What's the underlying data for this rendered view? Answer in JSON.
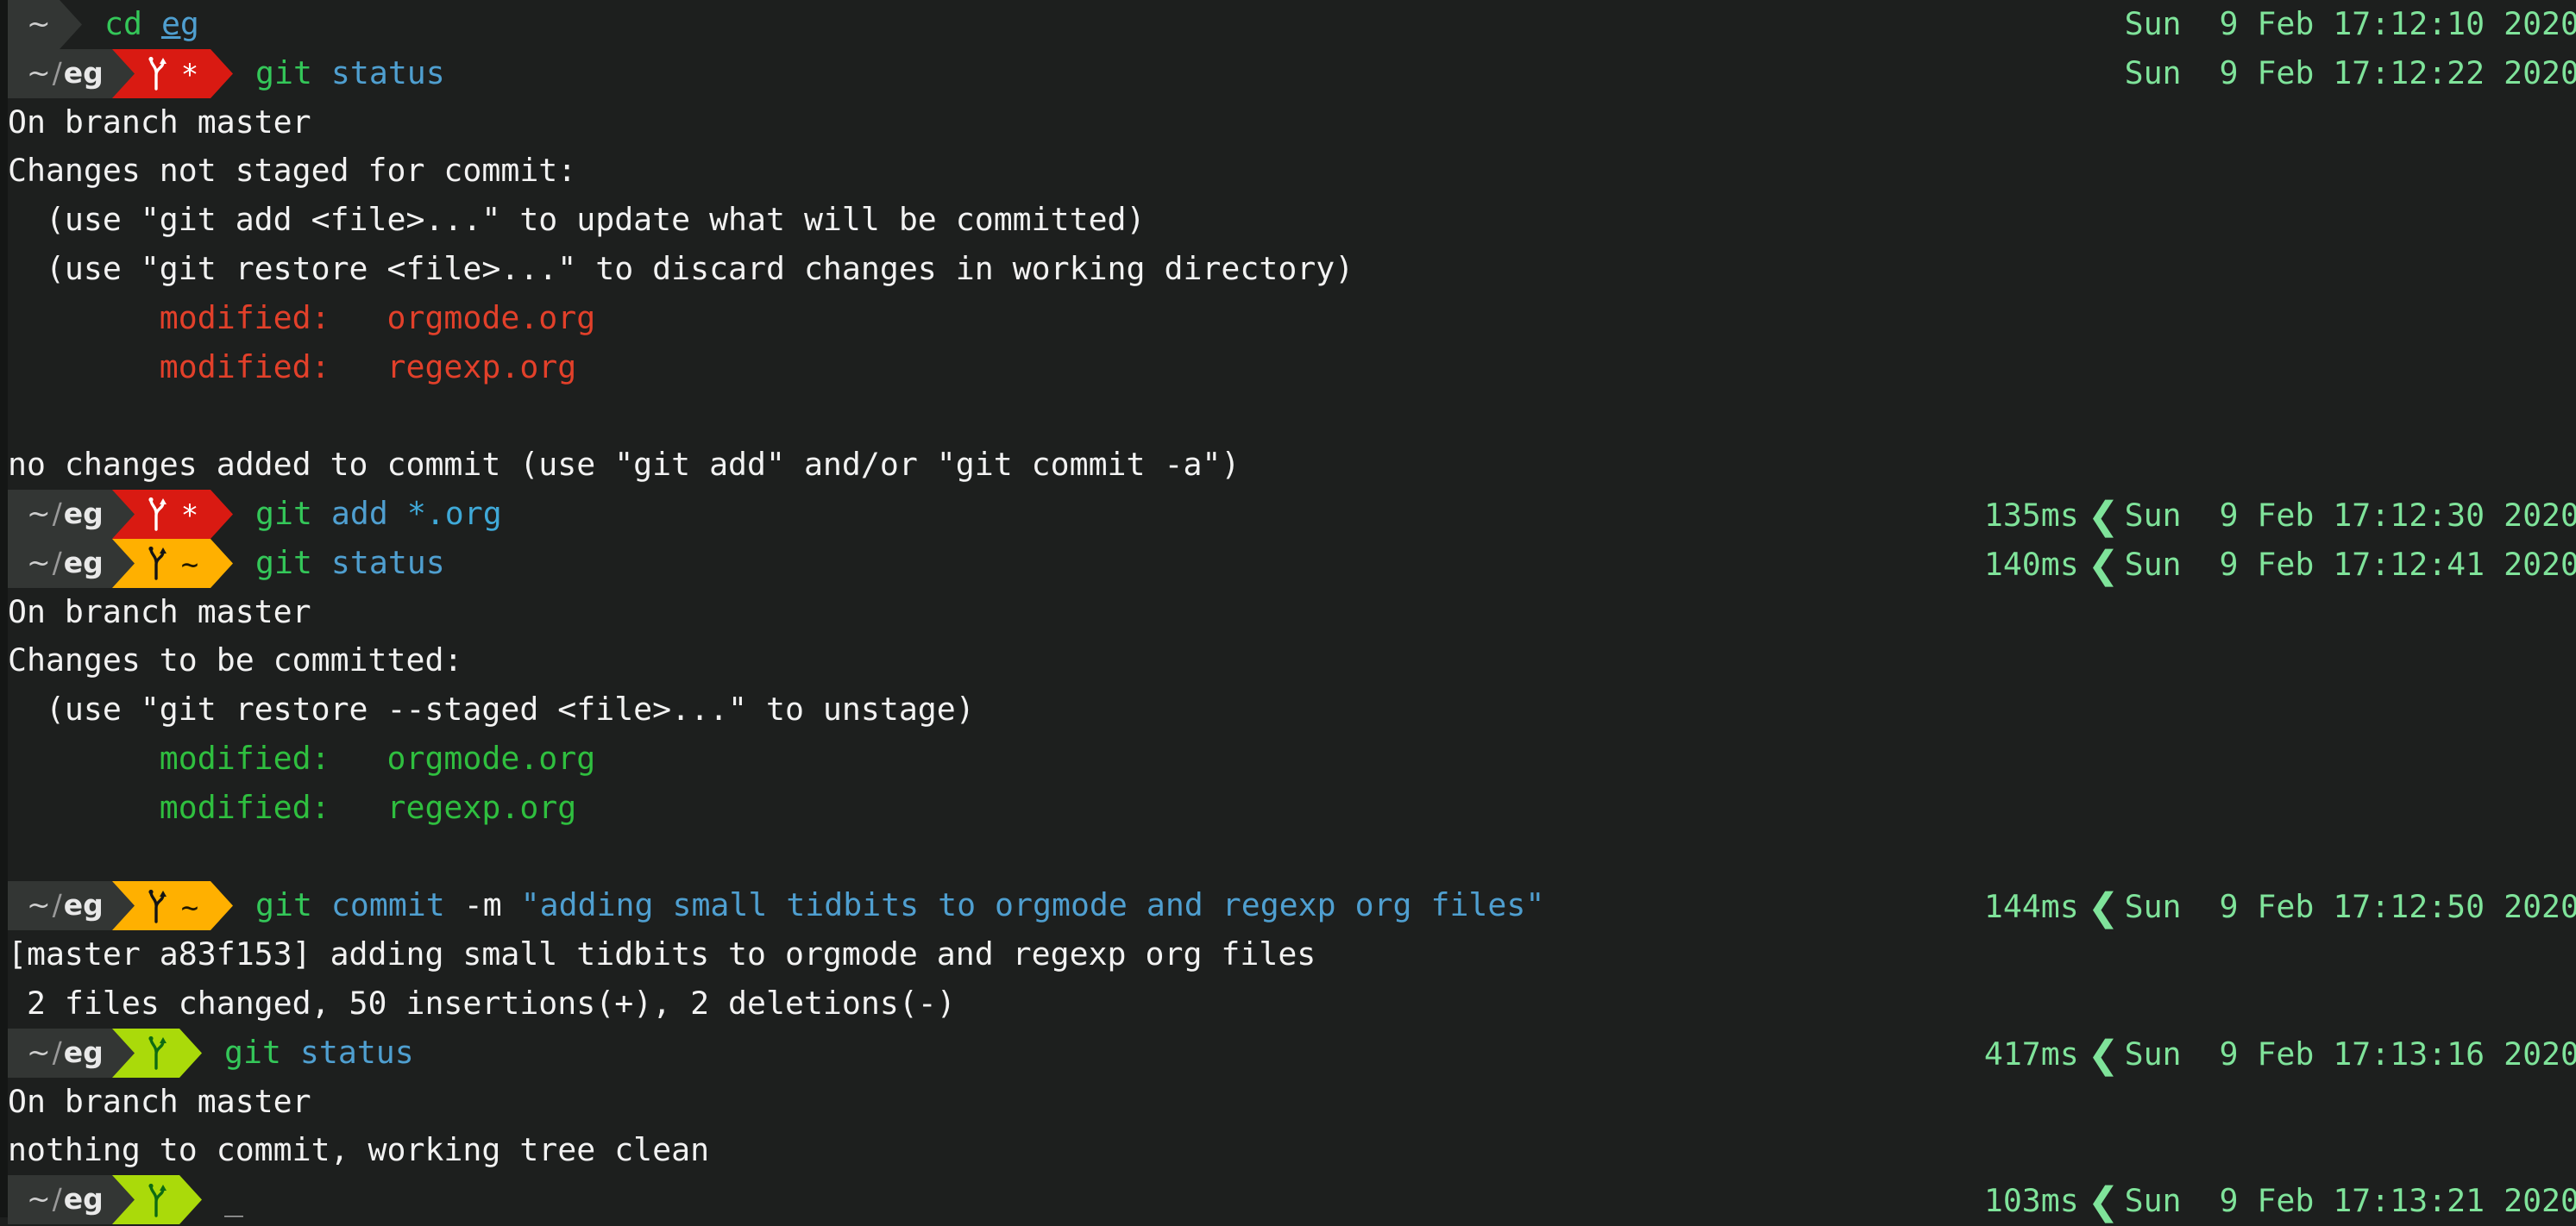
{
  "terminal": {
    "shell": "zsh-powerlevel",
    "colors": {
      "background": "#1d1f1e",
      "prompt_path_bg": "#333634",
      "git_dirty_bg": "#d91a12",
      "git_staged_bg": "#ffb000",
      "git_clean_bg": "#aada0a",
      "timestamp": "#7fe39a",
      "command_name": "#34c759",
      "command_arg": "#4f9fd0",
      "error_red": "#e2402a",
      "success_green": "#2fbf3f",
      "output_white": "#f2f2f2"
    },
    "icons": {
      "branch": "git-branch-icon",
      "separator_right": "powerline-right-arrow-icon",
      "separator_left_thin": "powerline-left-thin-chevron-icon",
      "dirty_mark": "*",
      "staged_mark": "~",
      "cursor": "_"
    }
  },
  "lines": [
    {
      "type": "prompt",
      "path": "~",
      "git": null,
      "command": [
        {
          "t": "cd ",
          "c": "c-green"
        },
        {
          "t": "eg",
          "c": "c-under"
        }
      ],
      "duration": "",
      "timestamp": "Sun  9 Feb 17:12:10 2020"
    },
    {
      "type": "prompt",
      "path": "~/eg",
      "git": {
        "state": "dirty",
        "mark": "*"
      },
      "command": [
        {
          "t": "git ",
          "c": "c-green"
        },
        {
          "t": "status",
          "c": "c-blue"
        }
      ],
      "duration": "",
      "timestamp": "Sun  9 Feb 17:12:22 2020"
    },
    {
      "type": "output",
      "spans": [
        {
          "t": "On branch master",
          "c": "c-white"
        }
      ]
    },
    {
      "type": "output",
      "spans": [
        {
          "t": "Changes not staged for commit:",
          "c": "c-white"
        }
      ]
    },
    {
      "type": "output",
      "spans": [
        {
          "t": "  (use \"git add <file>...\" to update what will be committed)",
          "c": "c-white"
        }
      ]
    },
    {
      "type": "output",
      "spans": [
        {
          "t": "  (use \"git restore <file>...\" to discard changes in working directory)",
          "c": "c-white"
        }
      ]
    },
    {
      "type": "output",
      "spans": [
        {
          "t": "        modified:   orgmode.org",
          "c": "c-red"
        }
      ]
    },
    {
      "type": "output",
      "spans": [
        {
          "t": "        modified:   regexp.org",
          "c": "c-red"
        }
      ]
    },
    {
      "type": "output",
      "spans": [
        {
          "t": "",
          "c": "c-white"
        }
      ]
    },
    {
      "type": "output",
      "spans": [
        {
          "t": "no changes added to commit (use \"git add\" and/or \"git commit -a\")",
          "c": "c-white"
        }
      ]
    },
    {
      "type": "prompt",
      "path": "~/eg",
      "git": {
        "state": "dirty",
        "mark": "*"
      },
      "command": [
        {
          "t": "git ",
          "c": "c-green"
        },
        {
          "t": "add ",
          "c": "c-blue"
        },
        {
          "t": "*.org",
          "c": "c-cyan"
        }
      ],
      "duration": "135ms",
      "timestamp": "Sun  9 Feb 17:12:30 2020"
    },
    {
      "type": "prompt",
      "path": "~/eg",
      "git": {
        "state": "staged",
        "mark": "~"
      },
      "command": [
        {
          "t": "git ",
          "c": "c-green"
        },
        {
          "t": "status",
          "c": "c-blue"
        }
      ],
      "duration": "140ms",
      "timestamp": "Sun  9 Feb 17:12:41 2020"
    },
    {
      "type": "output",
      "spans": [
        {
          "t": "On branch master",
          "c": "c-white"
        }
      ]
    },
    {
      "type": "output",
      "spans": [
        {
          "t": "Changes to be committed:",
          "c": "c-white"
        }
      ]
    },
    {
      "type": "output",
      "spans": [
        {
          "t": "  (use \"git restore --staged <file>...\" to unstage)",
          "c": "c-white"
        }
      ]
    },
    {
      "type": "output",
      "spans": [
        {
          "t": "        modified:   orgmode.org",
          "c": "c-ok"
        }
      ]
    },
    {
      "type": "output",
      "spans": [
        {
          "t": "        modified:   regexp.org",
          "c": "c-ok"
        }
      ]
    },
    {
      "type": "output",
      "spans": [
        {
          "t": "",
          "c": "c-white"
        }
      ]
    },
    {
      "type": "prompt",
      "path": "~/eg",
      "git": {
        "state": "staged",
        "mark": "~"
      },
      "command": [
        {
          "t": "git ",
          "c": "c-green"
        },
        {
          "t": "commit ",
          "c": "c-blue"
        },
        {
          "t": "-m ",
          "c": "c-white"
        },
        {
          "t": "\"adding small tidbits to orgmode and regexp org files\"",
          "c": "c-blue"
        }
      ],
      "duration": "144ms",
      "timestamp": "Sun  9 Feb 17:12:50 2020"
    },
    {
      "type": "output",
      "spans": [
        {
          "t": "[master a83f153] adding small tidbits to orgmode and regexp org files",
          "c": "c-white"
        }
      ]
    },
    {
      "type": "output",
      "spans": [
        {
          "t": " 2 files changed, 50 insertions(+), 2 deletions(-)",
          "c": "c-white"
        }
      ]
    },
    {
      "type": "prompt",
      "path": "~/eg",
      "git": {
        "state": "clean",
        "mark": ""
      },
      "command": [
        {
          "t": "git ",
          "c": "c-green"
        },
        {
          "t": "status",
          "c": "c-blue"
        }
      ],
      "duration": "417ms",
      "timestamp": "Sun  9 Feb 17:13:16 2020"
    },
    {
      "type": "output",
      "spans": [
        {
          "t": "On branch master",
          "c": "c-white"
        }
      ]
    },
    {
      "type": "output",
      "spans": [
        {
          "t": "nothing to commit, working tree clean",
          "c": "c-white"
        }
      ]
    },
    {
      "type": "prompt",
      "path": "~/eg",
      "git": {
        "state": "clean",
        "mark": ""
      },
      "command": [
        {
          "t": "_",
          "c": "cursor"
        }
      ],
      "duration": "103ms",
      "timestamp": "Sun  9 Feb 17:13:21 2020"
    }
  ]
}
